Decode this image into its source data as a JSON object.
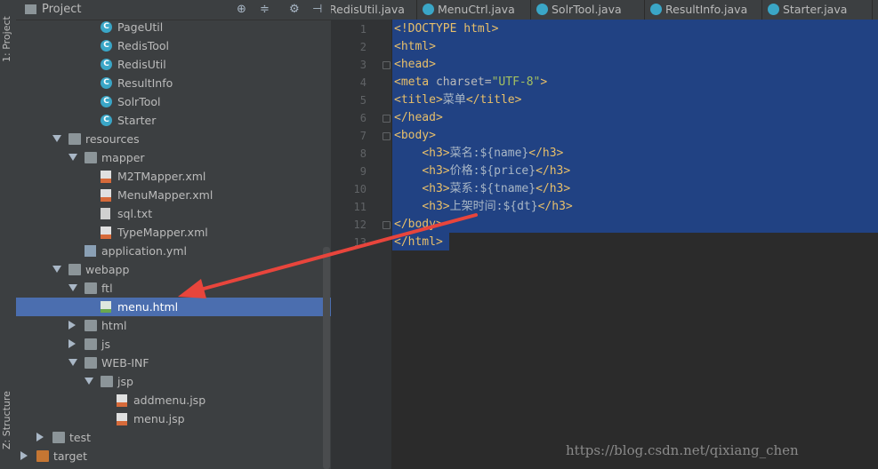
{
  "side_tabs": {
    "project": "1: Project",
    "structure": "Z: Structure"
  },
  "project_panel": {
    "title": "Project",
    "header_icons": [
      "target-icon",
      "collapse-icon",
      "gear-icon",
      "hide-icon"
    ],
    "tree": [
      {
        "label": "PageUtil",
        "type": "class",
        "indent": 5
      },
      {
        "label": "RedisTool",
        "type": "class",
        "indent": 5
      },
      {
        "label": "RedisUtil",
        "type": "class",
        "indent": 5
      },
      {
        "label": "ResultInfo",
        "type": "class",
        "indent": 5
      },
      {
        "label": "SolrTool",
        "type": "class",
        "indent": 5
      },
      {
        "label": "Starter",
        "type": "class",
        "indent": 5
      },
      {
        "label": "resources",
        "type": "folder",
        "indent": 3,
        "expanded": true
      },
      {
        "label": "mapper",
        "type": "folder",
        "indent": 4,
        "expanded": true
      },
      {
        "label": "M2TMapper.xml",
        "type": "xml",
        "indent": 5
      },
      {
        "label": "MenuMapper.xml",
        "type": "xml",
        "indent": 5
      },
      {
        "label": "sql.txt",
        "type": "txt",
        "indent": 5
      },
      {
        "label": "TypeMapper.xml",
        "type": "xml",
        "indent": 5
      },
      {
        "label": "application.yml",
        "type": "yml",
        "indent": 4
      },
      {
        "label": "webapp",
        "type": "folder",
        "indent": 3,
        "expanded": true
      },
      {
        "label": "ftl",
        "type": "folder",
        "indent": 4,
        "expanded": true
      },
      {
        "label": "menu.html",
        "type": "html",
        "indent": 5,
        "selected": true
      },
      {
        "label": "html",
        "type": "folder",
        "indent": 4,
        "expanded": false
      },
      {
        "label": "js",
        "type": "folder",
        "indent": 4,
        "expanded": false
      },
      {
        "label": "WEB-INF",
        "type": "folder",
        "indent": 4,
        "expanded": true
      },
      {
        "label": "jsp",
        "type": "folder",
        "indent": 5,
        "expanded": true
      },
      {
        "label": "addmenu.jsp",
        "type": "jsp",
        "indent": 6
      },
      {
        "label": "menu.jsp",
        "type": "jsp",
        "indent": 6
      },
      {
        "label": "test",
        "type": "folder",
        "indent": 2,
        "expanded": false
      },
      {
        "label": "target",
        "type": "folder-orange",
        "indent": 1,
        "expanded": false
      }
    ]
  },
  "tabs": [
    "RedisUtil.java",
    "MenuCtrl.java",
    "SolrTool.java",
    "ResultInfo.java",
    "Starter.java"
  ],
  "editor": {
    "line_numbers": [
      "1",
      "2",
      "3",
      "4",
      "5",
      "6",
      "7",
      "8",
      "9",
      "10",
      "11",
      "12",
      "13"
    ],
    "lines": [
      [
        {
          "c": "tag",
          "t": "<!DOCTYPE html>"
        }
      ],
      [
        {
          "c": "tag",
          "t": "<html>"
        }
      ],
      [
        {
          "c": "tag",
          "t": "<head>"
        }
      ],
      [
        {
          "c": "tag",
          "t": "<meta "
        },
        {
          "c": "attr",
          "t": "charset="
        },
        {
          "c": "str",
          "t": "\"UTF-8\""
        },
        {
          "c": "tag",
          "t": ">"
        }
      ],
      [
        {
          "c": "tag",
          "t": "<title>"
        },
        {
          "c": "txt",
          "t": "菜单"
        },
        {
          "c": "tag",
          "t": "</title>"
        }
      ],
      [
        {
          "c": "tag",
          "t": "</head>"
        }
      ],
      [
        {
          "c": "tag",
          "t": "<body>"
        }
      ],
      [
        {
          "c": "txt",
          "t": "    "
        },
        {
          "c": "tag",
          "t": "<h3>"
        },
        {
          "c": "txt",
          "t": "菜名:${name}"
        },
        {
          "c": "tag",
          "t": "</h3>"
        }
      ],
      [
        {
          "c": "txt",
          "t": "    "
        },
        {
          "c": "tag",
          "t": "<h3>"
        },
        {
          "c": "txt",
          "t": "价格:${price}"
        },
        {
          "c": "tag",
          "t": "</h3>"
        }
      ],
      [
        {
          "c": "txt",
          "t": "    "
        },
        {
          "c": "tag",
          "t": "<h3>"
        },
        {
          "c": "txt",
          "t": "菜系:${tname}"
        },
        {
          "c": "tag",
          "t": "</h3>"
        }
      ],
      [
        {
          "c": "txt",
          "t": "    "
        },
        {
          "c": "tag",
          "t": "<h3>"
        },
        {
          "c": "txt",
          "t": "上架时间:${dt}"
        },
        {
          "c": "tag",
          "t": "</h3>"
        }
      ],
      [
        {
          "c": "tag",
          "t": "</body>"
        }
      ],
      [
        {
          "c": "tag",
          "t": "</html>"
        }
      ]
    ]
  },
  "watermark": "https://blog.csdn.net/qixiang_chen",
  "colors": {
    "selection": "#214283",
    "tree_selected": "#4b6eaf",
    "tag": "#e8bf6a",
    "string": "#a5c261",
    "arrow": "#e8453c"
  }
}
